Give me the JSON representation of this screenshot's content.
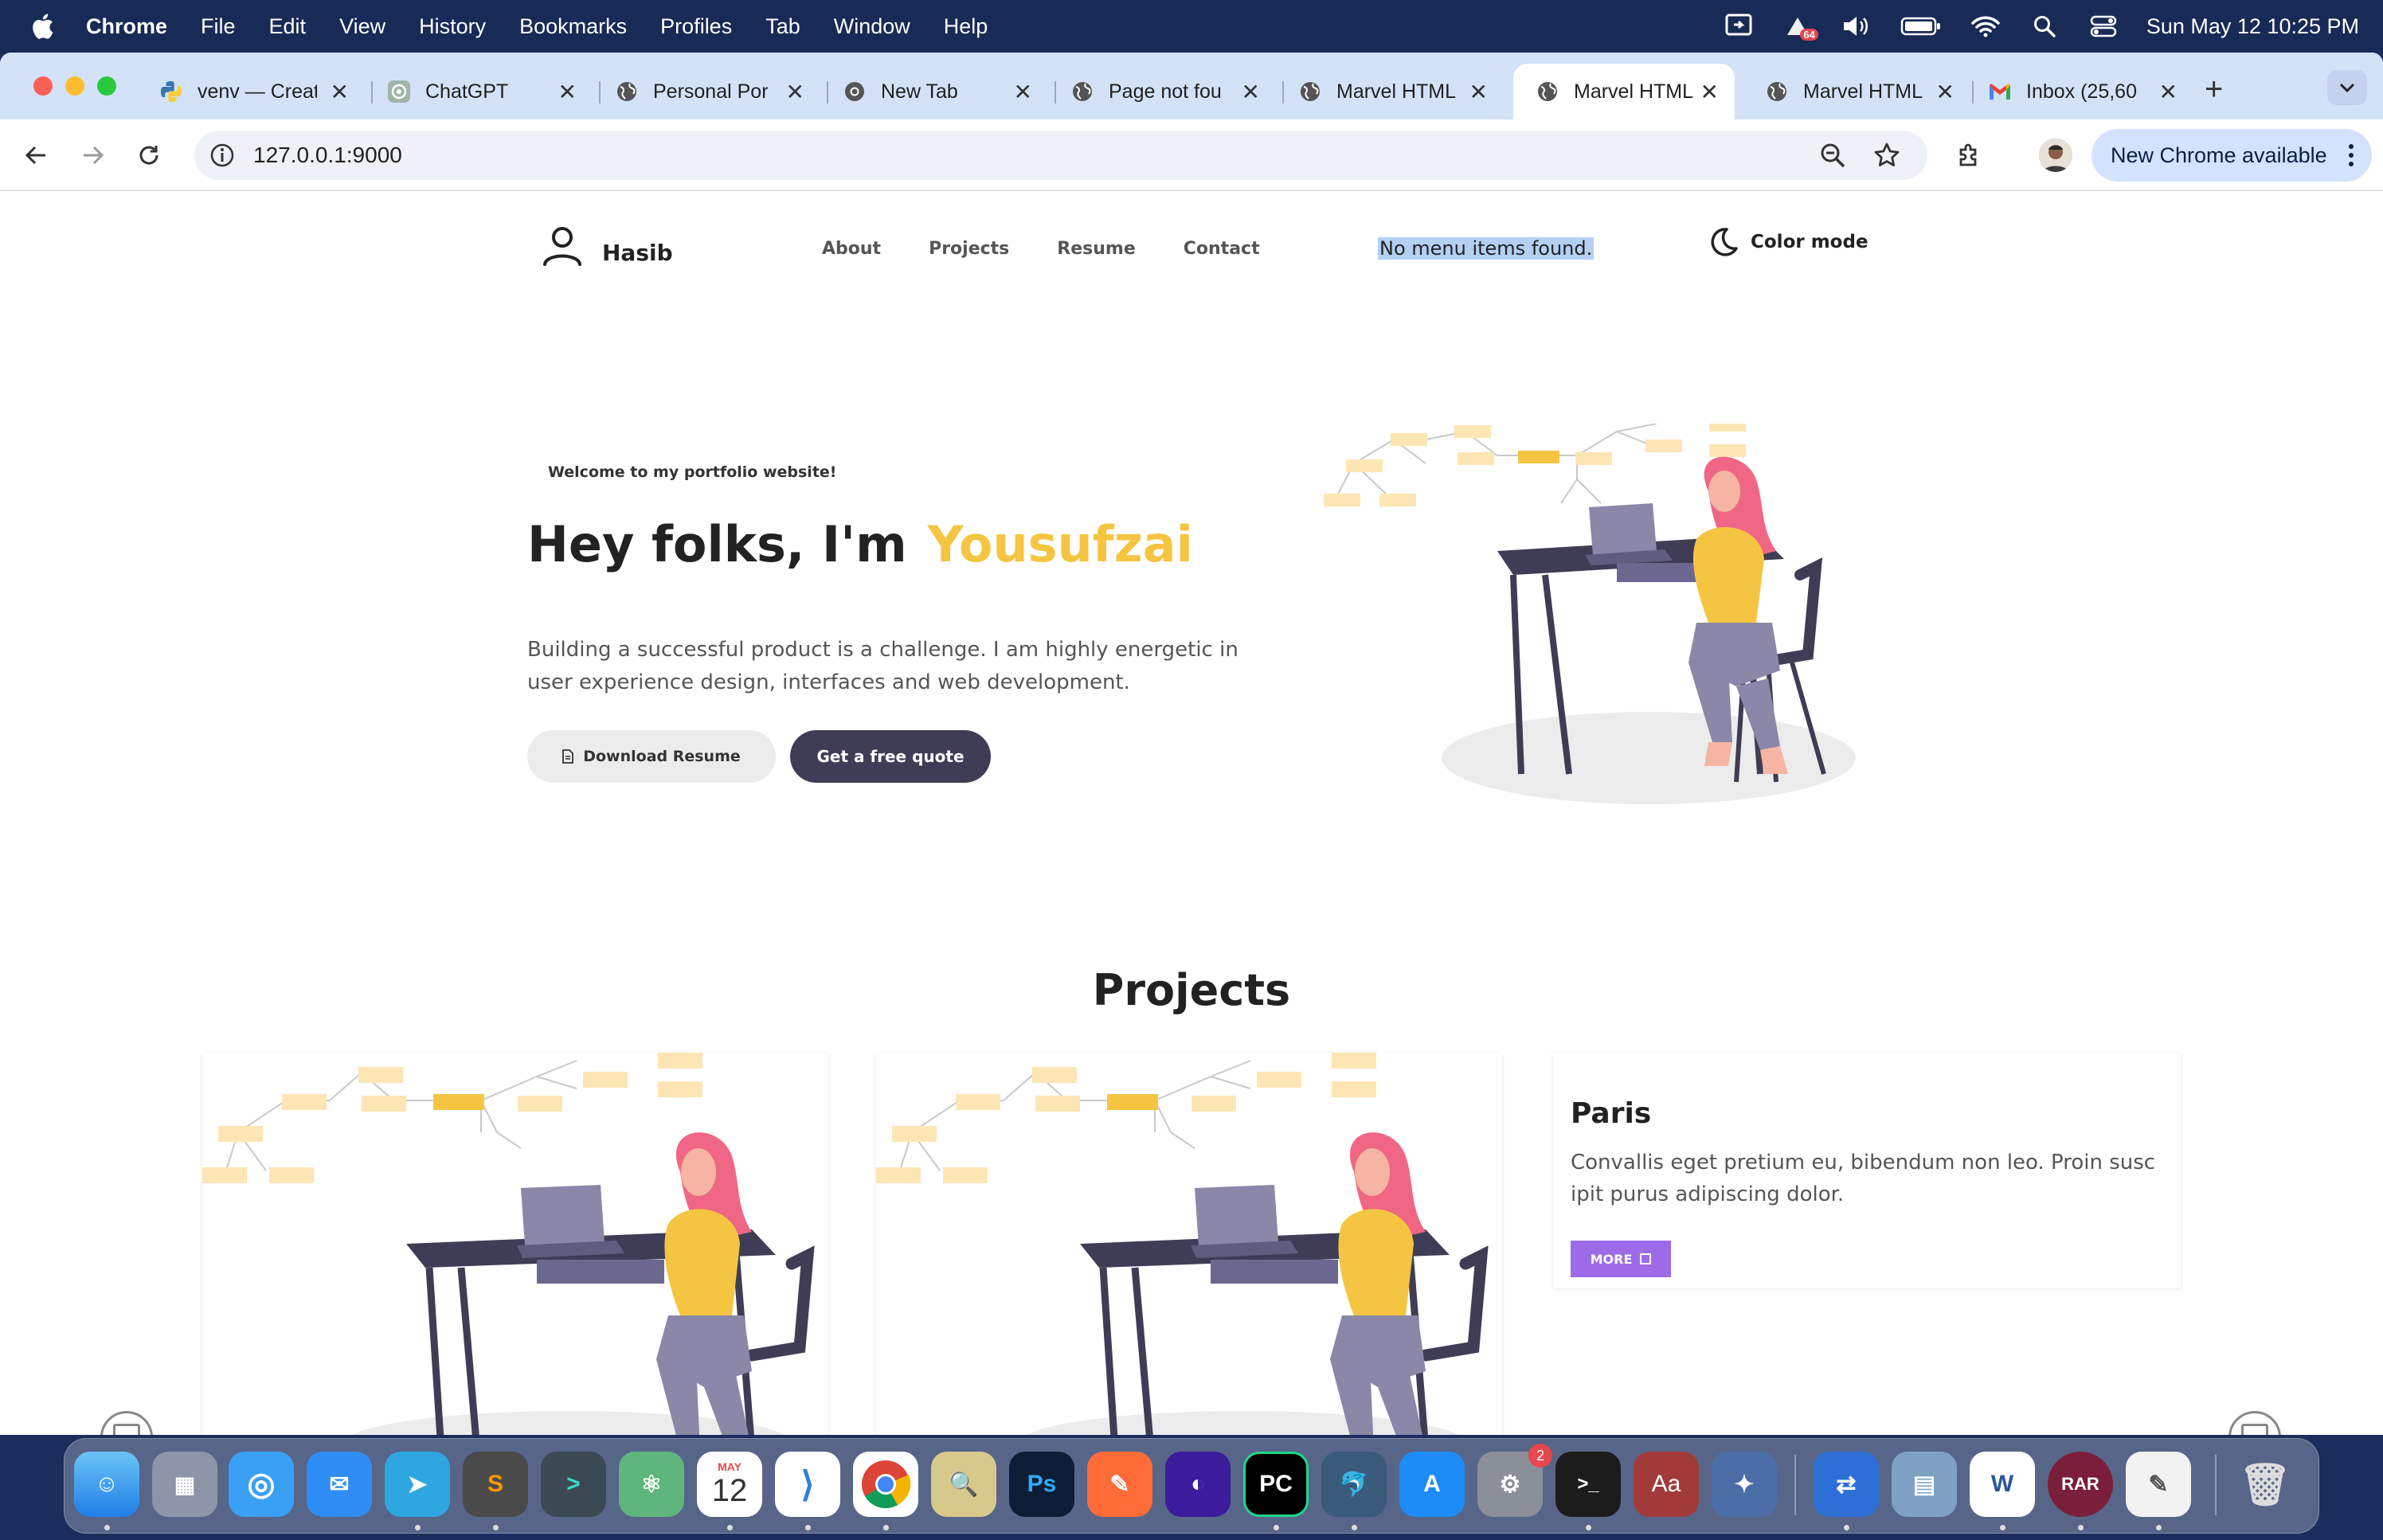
{
  "menubar": {
    "app": "Chrome",
    "items": [
      "File",
      "Edit",
      "View",
      "History",
      "Bookmarks",
      "Profiles",
      "Tab",
      "Window",
      "Help"
    ],
    "battery_badge": "64",
    "clock": "Sun May 12  10:25 PM"
  },
  "tabs": [
    {
      "title": "venv — Creat",
      "icon": "python-icon"
    },
    {
      "title": "ChatGPT",
      "icon": "chatgpt-icon"
    },
    {
      "title": "Personal Por",
      "icon": "globe-icon"
    },
    {
      "title": "New Tab",
      "icon": "chrome-icon"
    },
    {
      "title": "Page not fou",
      "icon": "globe-icon"
    },
    {
      "title": "Marvel HTML",
      "icon": "globe-icon"
    },
    {
      "title": "Marvel HTML",
      "icon": "globe-icon",
      "active": true
    },
    {
      "title": "Marvel HTML",
      "icon": "globe-icon"
    },
    {
      "title": "Inbox (25,60",
      "icon": "gmail-icon"
    }
  ],
  "toolbar": {
    "url": "127.0.0.1:9000",
    "update_label": "New Chrome available"
  },
  "site": {
    "brand": "Hasib",
    "nav": [
      "About",
      "Projects",
      "Resume",
      "Contact"
    ],
    "no_menu": "No menu items found.",
    "color_mode": "Color mode",
    "welcome": "Welcome to my portfolio website!",
    "hero_prefix": "Hey folks, I'm",
    "hero_name": "Yousufzai",
    "hero_text": "Building a successful product is a challenge. I am highly energetic in user experience design, interfaces and web development.",
    "download_label": "Download Resume",
    "quote_label": "Get a free quote",
    "projects_heading": "Projects",
    "card": {
      "title": "Paris",
      "text": "Convallis eget pretium eu, bibendum non leo. Proin susc ipit purus adipiscing dolor.",
      "more": "MORE"
    }
  },
  "dock": {
    "calendar_month": "MAY",
    "calendar_day": "12",
    "settings_badge": "2",
    "apps": [
      "Finder",
      "Launchpad",
      "Safari",
      "Mail",
      "Telegram",
      "Sublime Text",
      "Prompt",
      "Atom",
      "Calendar",
      "VS Code",
      "Chrome",
      "Preview",
      "Photoshop",
      "Postman",
      "Screen",
      "PyCharm",
      "MySQL Workbench",
      "App Store",
      "System Settings",
      "Terminal",
      "Dictionary",
      "Xcode Tools",
      "Remote Desktop",
      "Preview Photos",
      "Word",
      "RAR",
      "TextEdit",
      "Trash"
    ]
  },
  "colors": {
    "accent_yellow": "#f5c542",
    "dark_button": "#3f3d56",
    "more_purple": "#9d6be8",
    "menubar_bg": "#182a56"
  }
}
